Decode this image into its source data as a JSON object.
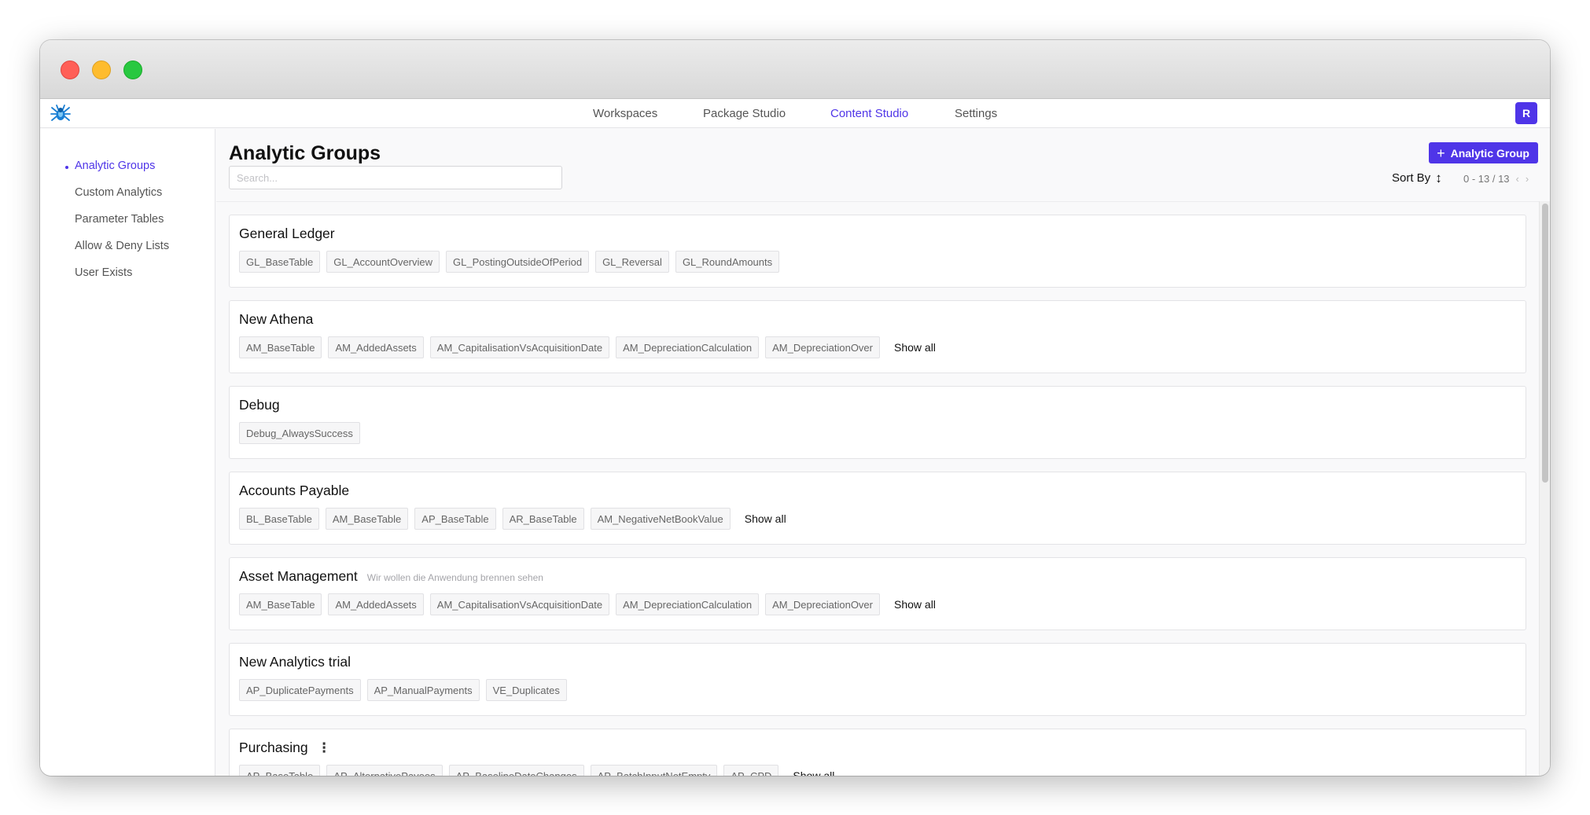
{
  "nav": {
    "items": [
      {
        "label": "Workspaces",
        "active": false
      },
      {
        "label": "Package Studio",
        "active": false
      },
      {
        "label": "Content Studio",
        "active": true
      },
      {
        "label": "Settings",
        "active": false
      }
    ],
    "avatar_initial": "R"
  },
  "sidebar": {
    "items": [
      {
        "label": "Analytic Groups",
        "active": true
      },
      {
        "label": "Custom Analytics",
        "active": false
      },
      {
        "label": "Parameter Tables",
        "active": false
      },
      {
        "label": "Allow & Deny Lists",
        "active": false
      },
      {
        "label": "User Exists",
        "active": false
      }
    ]
  },
  "header": {
    "title": "Analytic Groups",
    "search_placeholder": "Search...",
    "add_button_label": "Analytic Group",
    "sort_label": "Sort By",
    "pager_range": "0 - 13 / 13"
  },
  "groups": [
    {
      "name": "General Ledger",
      "description": "",
      "chips": [
        "GL_BaseTable",
        "GL_AccountOverview",
        "GL_PostingOutsideOfPeriod",
        "GL_Reversal",
        "GL_RoundAmounts"
      ],
      "show_all": ""
    },
    {
      "name": "New Athena",
      "description": "",
      "chips": [
        "AM_BaseTable",
        "AM_AddedAssets",
        "AM_CapitalisationVsAcquisitionDate",
        "AM_DepreciationCalculation",
        "AM_DepreciationOver"
      ],
      "show_all": "Show all"
    },
    {
      "name": "Debug",
      "description": "",
      "chips": [
        "Debug_AlwaysSuccess"
      ],
      "show_all": ""
    },
    {
      "name": "Accounts Payable",
      "description": "",
      "chips": [
        "BL_BaseTable",
        "AM_BaseTable",
        "AP_BaseTable",
        "AR_BaseTable",
        "AM_NegativeNetBookValue"
      ],
      "show_all": "Show all"
    },
    {
      "name": "Asset Management",
      "description": "Wir wollen die Anwendung brennen sehen",
      "chips": [
        "AM_BaseTable",
        "AM_AddedAssets",
        "AM_CapitalisationVsAcquisitionDate",
        "AM_DepreciationCalculation",
        "AM_DepreciationOver"
      ],
      "show_all": "Show all"
    },
    {
      "name": "New Analytics trial",
      "description": "",
      "chips": [
        "AP_DuplicatePayments",
        "AP_ManualPayments",
        "VE_Duplicates"
      ],
      "show_all": ""
    },
    {
      "name": "Purchasing",
      "description": "",
      "chips": [
        "AP_BaseTable",
        "AP_AlternativePayees",
        "AP_BaselineDateChanges",
        "AP_BatchInputNotEmpty",
        "AP_CPD"
      ],
      "show_all": "Show all",
      "has_menu": true
    }
  ],
  "colors": {
    "accent": "#4f35e8"
  }
}
